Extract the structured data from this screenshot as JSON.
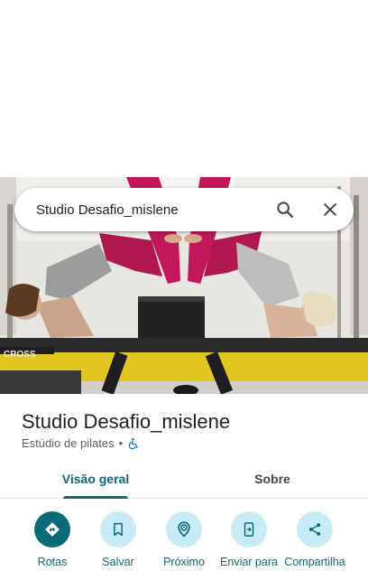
{
  "search": {
    "query": "Studio Desafio_mislene"
  },
  "place": {
    "name": "Studio Desafio_mislene",
    "category": "Estúdio de pilates",
    "separator": "•",
    "accessibility_icon": "wheelchair-icon"
  },
  "photo": {
    "banner_text": "CROSS"
  },
  "tabs": [
    {
      "label": "Visão geral",
      "selected": true
    },
    {
      "label": "Sobre",
      "selected": false
    }
  ],
  "actions": [
    {
      "label": "Rotas",
      "icon": "directions-icon",
      "primary": true
    },
    {
      "label": "Salvar",
      "icon": "bookmark-icon",
      "primary": false
    },
    {
      "label": "Próximo",
      "icon": "nearby-icon",
      "primary": false
    },
    {
      "label": "Enviar para",
      "icon": "send-to-phone-icon",
      "primary": false
    },
    {
      "label": "Compartilha",
      "icon": "share-icon",
      "primary": false
    }
  ],
  "colors": {
    "accent": "#0b6a77",
    "action_bg": "#c8ecf5",
    "text_primary": "#1f1f1f",
    "text_secondary": "#5e5e5e",
    "accessibility_icon": "#1a73e8"
  }
}
